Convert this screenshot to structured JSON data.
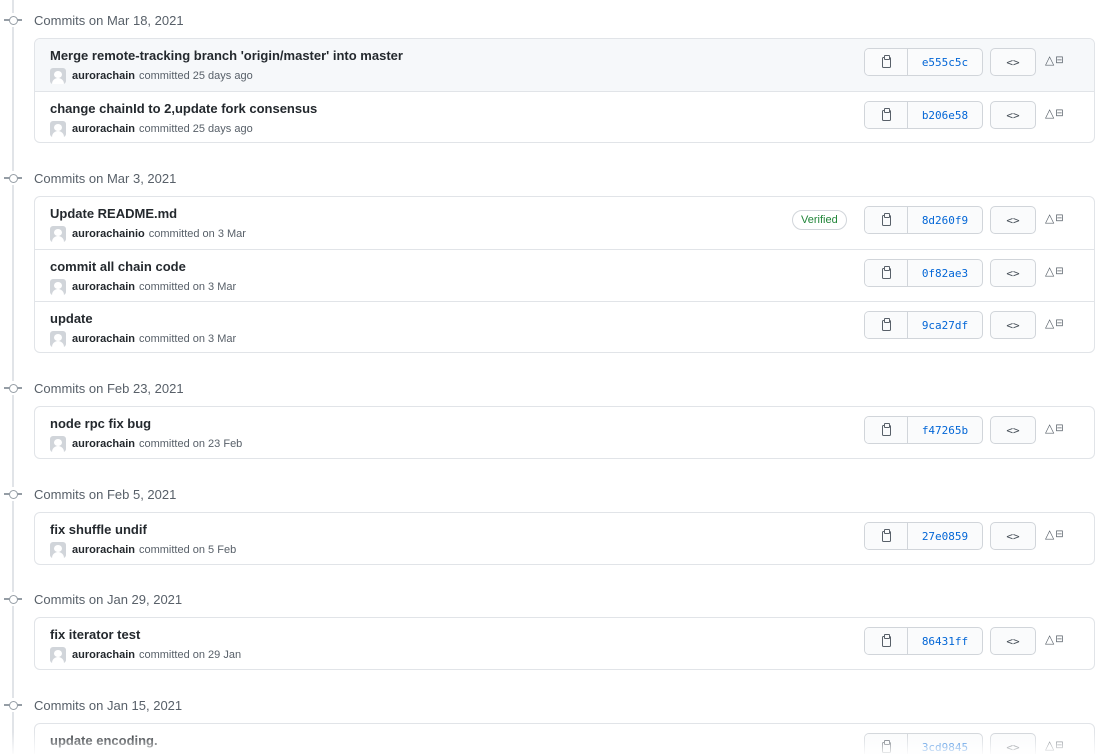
{
  "groups": [
    {
      "date_label": "Commits on Mar 18, 2021",
      "commits": [
        {
          "message": "Merge remote-tracking branch 'origin/master' into master",
          "author": "aurorachain",
          "when": "committed 25 days ago",
          "sha": "e555c5c",
          "verified": ""
        },
        {
          "message": "change chainId to 2,update fork consensus",
          "author": "aurorachain",
          "when": "committed 25 days ago",
          "sha": "b206e58",
          "verified": ""
        }
      ]
    },
    {
      "date_label": "Commits on Mar 3, 2021",
      "commits": [
        {
          "message": "Update README.md",
          "author": "aurorachainio",
          "when": "committed on 3 Mar",
          "sha": "8d260f9",
          "verified": "Verified"
        },
        {
          "message": "commit all chain code",
          "author": "aurorachain",
          "when": "committed on 3 Mar",
          "sha": "0f82ae3",
          "verified": ""
        },
        {
          "message": "update",
          "author": "aurorachain",
          "when": "committed on 3 Mar",
          "sha": "9ca27df",
          "verified": ""
        }
      ]
    },
    {
      "date_label": "Commits on Feb 23, 2021",
      "commits": [
        {
          "message": "node rpc fix bug",
          "author": "aurorachain",
          "when": "committed on 23 Feb",
          "sha": "f47265b",
          "verified": ""
        }
      ]
    },
    {
      "date_label": "Commits on Feb 5, 2021",
      "commits": [
        {
          "message": "fix shuffle undif",
          "author": "aurorachain",
          "when": "committed on 5 Feb",
          "sha": "27e0859",
          "verified": ""
        }
      ]
    },
    {
      "date_label": "Commits on Jan 29, 2021",
      "commits": [
        {
          "message": "fix iterator test",
          "author": "aurorachain",
          "when": "committed on 29 Jan",
          "sha": "86431ff",
          "verified": ""
        }
      ]
    },
    {
      "date_label": "Commits on Jan 15, 2021",
      "commits": [
        {
          "message": "update encoding.",
          "author": "",
          "when": "",
          "sha": "3cd9845",
          "verified": ""
        }
      ]
    }
  ],
  "icons": {
    "code_button": "<>",
    "misc_triangle": "△",
    "misc_square": "⊟"
  }
}
